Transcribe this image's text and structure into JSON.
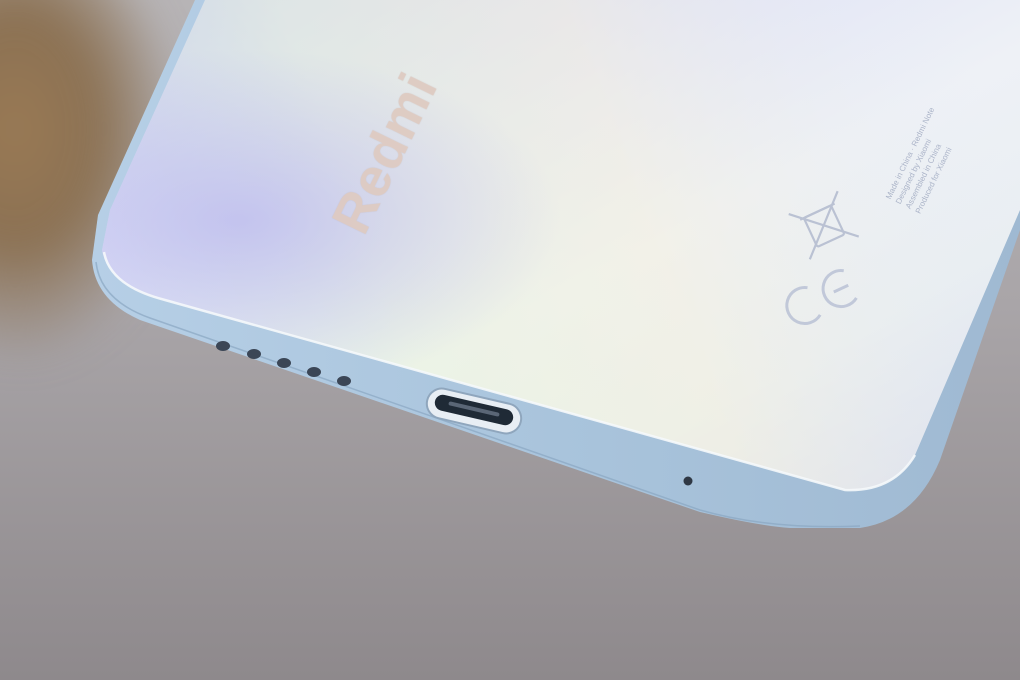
{
  "brand": {
    "logo_text": "Redmi"
  },
  "regulatory": {
    "lines": [
      "Made in China · Redmi Note",
      "Designed by Xiaomi",
      "Assembled in China",
      "Produced for Xiaomi"
    ],
    "ce_mark": "CE",
    "weee_icon": "crossed-bin-icon"
  },
  "ports": {
    "speaker_grille_holes": 5,
    "usb_port": "usb-c-port",
    "microphone": "mic-hole"
  },
  "colors": {
    "back_panel": "#dfe3f5",
    "frame": "#a9c3dc",
    "background": "#9a9598"
  }
}
